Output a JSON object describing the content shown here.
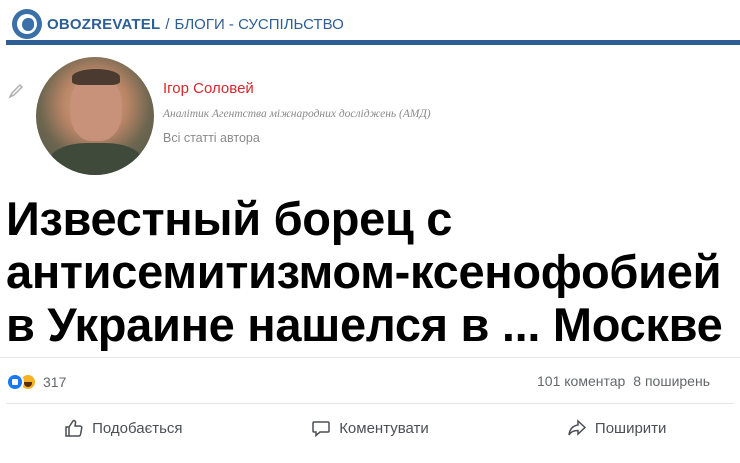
{
  "header": {
    "logo_text": "OBOZREVATEL",
    "separator": "/",
    "breadcrumb": "БЛОГИ - СУСПІЛЬСТВО",
    "brand_color": "#2d5e94"
  },
  "author": {
    "name": "Ігор Соловей",
    "role": "Аналітик Агентства міжнародних досліджень (АМД)",
    "all_articles_link": "Всі статті автора",
    "name_color": "#d9262c",
    "icons": [
      "pen-icon",
      "avatar"
    ]
  },
  "article": {
    "headline_lines": [
      "Известный борец с",
      "антисемитизмом-ксенофобией",
      "в Украине нашелся в ... Москве"
    ]
  },
  "social": {
    "reaction_icons": [
      "like-reaction-icon",
      "haha-reaction-icon"
    ],
    "reaction_count": "317",
    "comments": "101 коментар",
    "shares": "8 поширень",
    "actions": {
      "like": "Подобається",
      "comment": "Коментувати",
      "share": "Поширити"
    }
  }
}
